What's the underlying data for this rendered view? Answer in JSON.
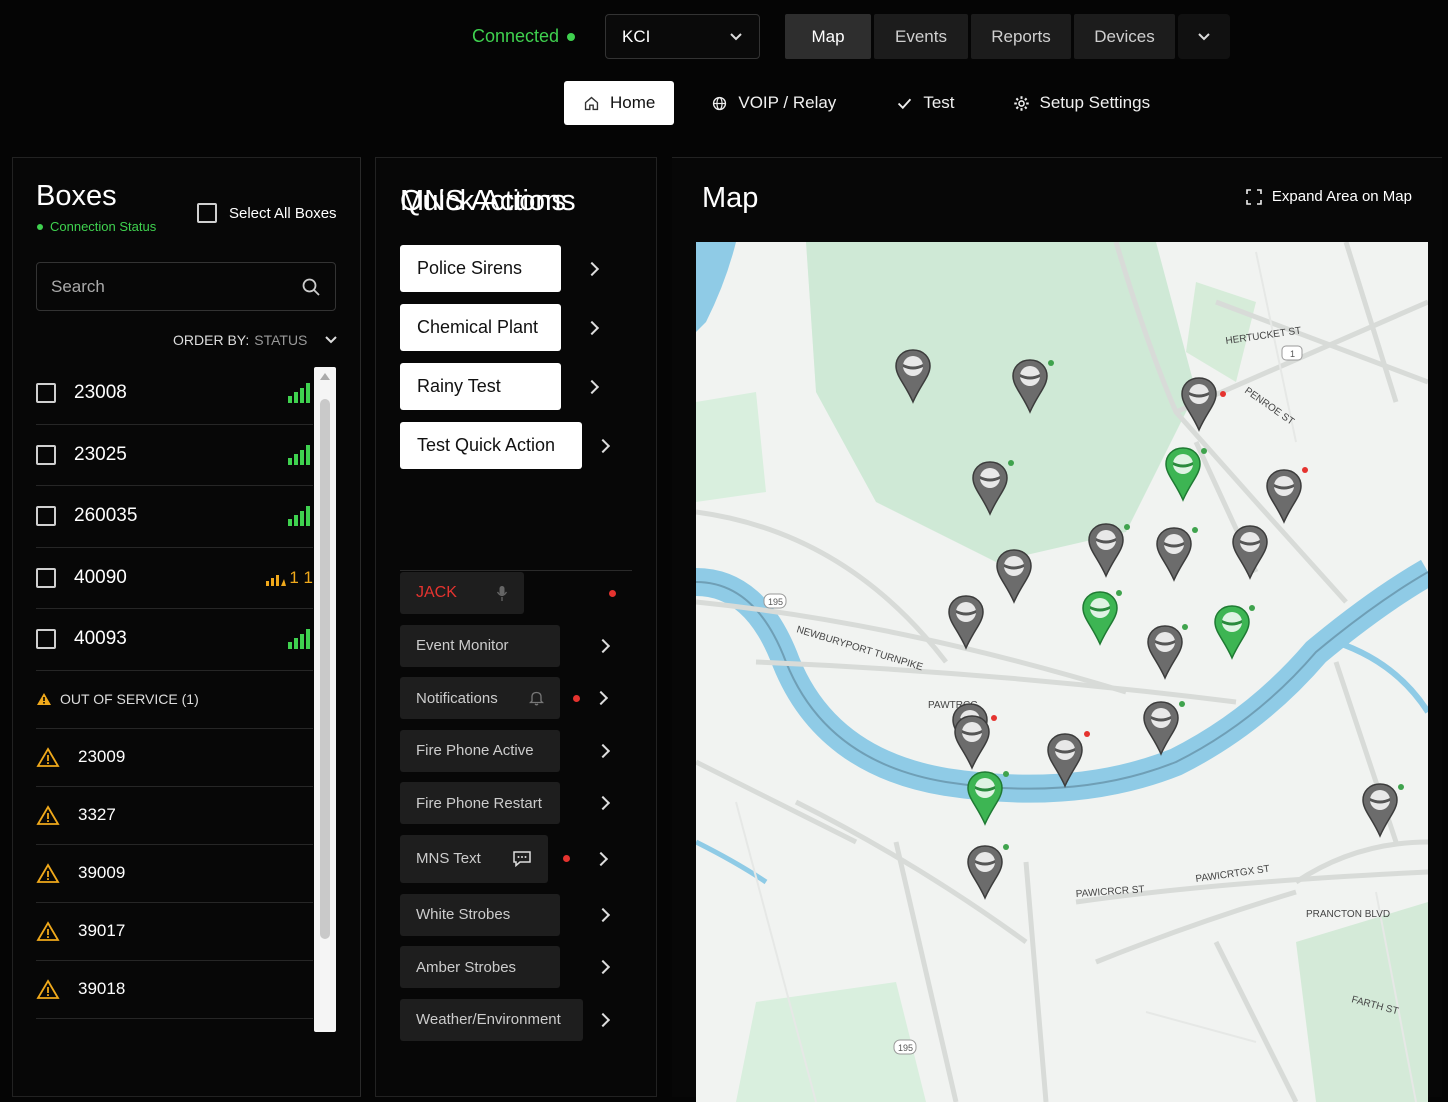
{
  "topbar": {
    "connection": "Connected",
    "site": "KCI",
    "tabs": [
      "Map",
      "Events",
      "Reports",
      "Devices"
    ],
    "active_tab": "Map"
  },
  "subnav": {
    "home": "Home",
    "voip": "VOIP / Relay",
    "test": "Test",
    "setup": "Setup Settings"
  },
  "boxes": {
    "title": "Boxes",
    "connection_status": "Connection Status",
    "select_all": "Select All Boxes",
    "search_placeholder": "Search",
    "order_by_label": "ORDER BY:",
    "order_by_value": "STATUS",
    "items": [
      {
        "id": "23008",
        "signal": "good"
      },
      {
        "id": "23025",
        "signal": "good"
      },
      {
        "id": "260035",
        "signal": "good"
      },
      {
        "id": "40090",
        "signal": "warning",
        "warning_text": "1 1"
      },
      {
        "id": "40093",
        "signal": "good"
      }
    ],
    "out_of_service_label": "OUT OF SERVICE (1)",
    "out_of_service": [
      "23009",
      "3327",
      "39009",
      "39017",
      "39018"
    ]
  },
  "quick_actions": {
    "title": "Quick Actions",
    "items": [
      "Police Sirens",
      "Chemical Plant",
      "Rainy Test",
      "Test Quick Action"
    ]
  },
  "mns_actions": {
    "title": "MNS Actions",
    "items": [
      {
        "label": "JACK",
        "icon": "microphone-icon",
        "alert": true
      },
      {
        "label": "Event Monitor",
        "icon": "",
        "alert": false
      },
      {
        "label": "Notifications",
        "icon": "bell-icon",
        "alert": true
      },
      {
        "label": "Fire Phone Active",
        "icon": "",
        "alert": false
      },
      {
        "label": "Fire Phone Restart",
        "icon": "",
        "alert": false
      },
      {
        "label": "MNS Text",
        "icon": "chat-icon",
        "alert": true
      },
      {
        "label": "White Strobes",
        "icon": "",
        "alert": false
      },
      {
        "label": "Amber Strobes",
        "icon": "",
        "alert": false
      },
      {
        "label": "Weather/Environment",
        "icon": "",
        "alert": false
      }
    ]
  },
  "map": {
    "title": "Map",
    "expand_label": "Expand Area on Map",
    "streets": [
      "HERTUCKET ST",
      "PENROE ST",
      "NEWBURYPORT TURNPIKE",
      "PAWTRCC",
      "PRANCTON BLVD",
      "PAWICRTGX ST",
      "PAWICRCR ST",
      "FARTH ST"
    ],
    "route_badges": [
      "195",
      "1",
      "195"
    ]
  },
  "colors": {
    "accent_green": "#3fd14f",
    "alert_red": "#e5332f",
    "warning_orange": "#f0a91b",
    "river": "#8fcbe6",
    "park": "#cfe9d6"
  }
}
